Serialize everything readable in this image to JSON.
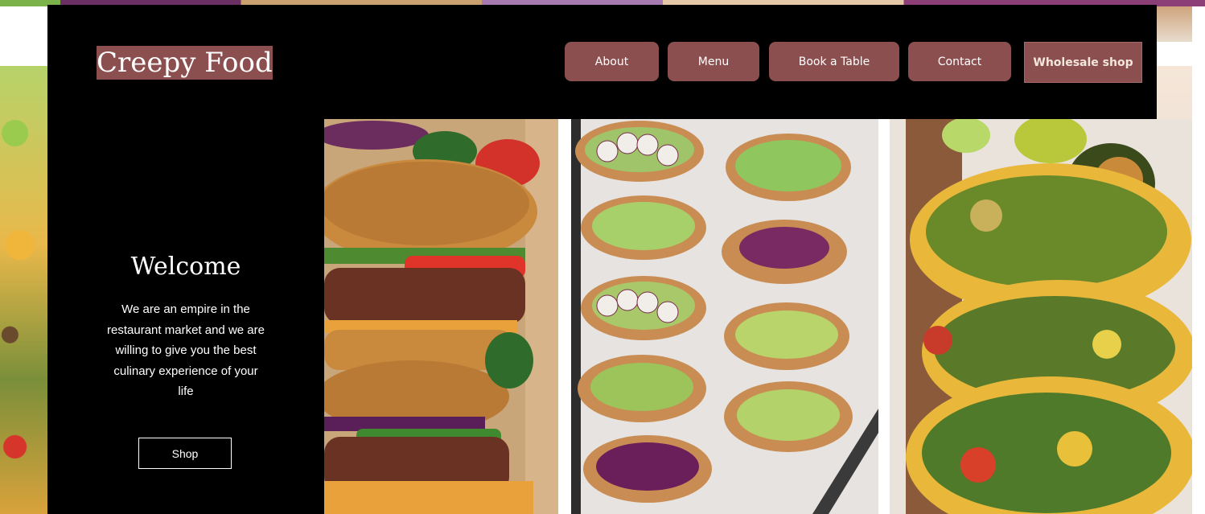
{
  "brand": {
    "logo_text": "Creepy Food"
  },
  "nav": {
    "items": [
      {
        "label": "About"
      },
      {
        "label": "Menu"
      },
      {
        "label": "Book a Table"
      },
      {
        "label": "Contact"
      },
      {
        "label": "Wholesale shop"
      }
    ]
  },
  "hero": {
    "title": "Welcome",
    "body": "We are an empire in the restaurant market and we are willing to give you the best culinary experience of your life",
    "cta_label": "Shop"
  },
  "colors": {
    "accent": "#8b4f4f",
    "header_bg": "#000000",
    "text": "#ffffff"
  },
  "images": {
    "burger": "burger-stack-image",
    "toast": "avocado-toast-image",
    "taco": "veggie-taco-image"
  }
}
